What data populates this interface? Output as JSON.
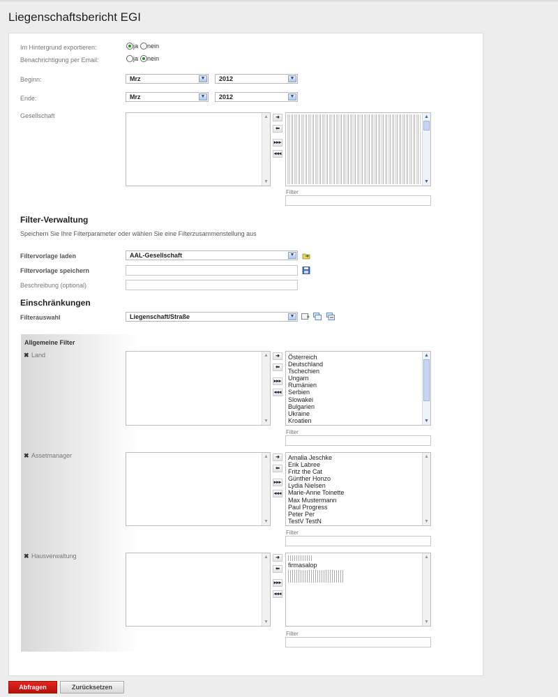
{
  "title": "Liegenschaftsbericht EGI",
  "options": {
    "background_export": {
      "label": "Im Hintergrund exportieren:",
      "yes": "ja",
      "no": "nein",
      "selected": "ja"
    },
    "email_notification": {
      "label": "Benachrichtigung per Email:",
      "yes": "ja",
      "no": "nein",
      "selected": "nein"
    }
  },
  "beginn": {
    "label": "Beginn:",
    "month": "Mrz",
    "year": "2012"
  },
  "ende": {
    "label": "Ende:",
    "month": "Mrz",
    "year": "2012"
  },
  "gesellschaft": {
    "label": "Gesellschaft",
    "filter_label": "Filter",
    "filter_value": ""
  },
  "filter_verwaltung": {
    "title": "Filter-Verwaltung",
    "description": "Speichern Sie Ihre Filterparameter oder wählen Sie eine Filterzusammenstellung aus",
    "load_label": "Filtervorlage laden",
    "load_value": "AAL-Gesellschaft",
    "save_label": "Filtervorlage speichern",
    "save_value": "",
    "desc_label": "Beschreibung (optional)",
    "desc_value": ""
  },
  "einschraenkungen": {
    "title": "Einschränkungen",
    "filterauswahl_label": "Filterauswahl",
    "filterauswahl_value": "Liegenschaft/Straße"
  },
  "allgemeine_filter": {
    "title": "Allgemeine Filter",
    "land": {
      "label": "Land",
      "items": [
        "Österreich",
        "Deutschland",
        "Tschechien",
        "Ungarn",
        "Rumänien",
        "Serbien",
        "Slowakei",
        "Bulgarien",
        "Ukraine",
        "Kroatien"
      ],
      "filter_label": "Filter",
      "filter_value": ""
    },
    "assetmanager": {
      "label": "Assetmanager",
      "items": [
        "Amalia Jeschke",
        "Erik Labree",
        "Fritz the Cat",
        "Günther Honzo",
        "Lydia Nielsen",
        "Marie-Anne Toinette",
        "Max Mustermann",
        "Paul Progress",
        "Peter Per",
        "TestV TestN"
      ],
      "filter_label": "Filter",
      "filter_value": ""
    },
    "hausverwaltung": {
      "label": "Hausverwaltung",
      "items": [
        "firmasalop"
      ],
      "filter_label": "Filter",
      "filter_value": ""
    }
  },
  "buttons": {
    "submit": "Abfragen",
    "reset": "Zurücksetzen"
  },
  "colors": {
    "submit": "#c8150f",
    "radio_on": "#2a8a2a",
    "scroll_arrow": "#3a62b3"
  },
  "icons": {
    "move_right": "arrow-right",
    "move_left": "arrow-left",
    "move_all_right": "triple-arrow-right",
    "move_all_left": "triple-arrow-left",
    "load": "folder-load-icon",
    "save": "floppy-disk-icon",
    "remove": "x-icon"
  }
}
